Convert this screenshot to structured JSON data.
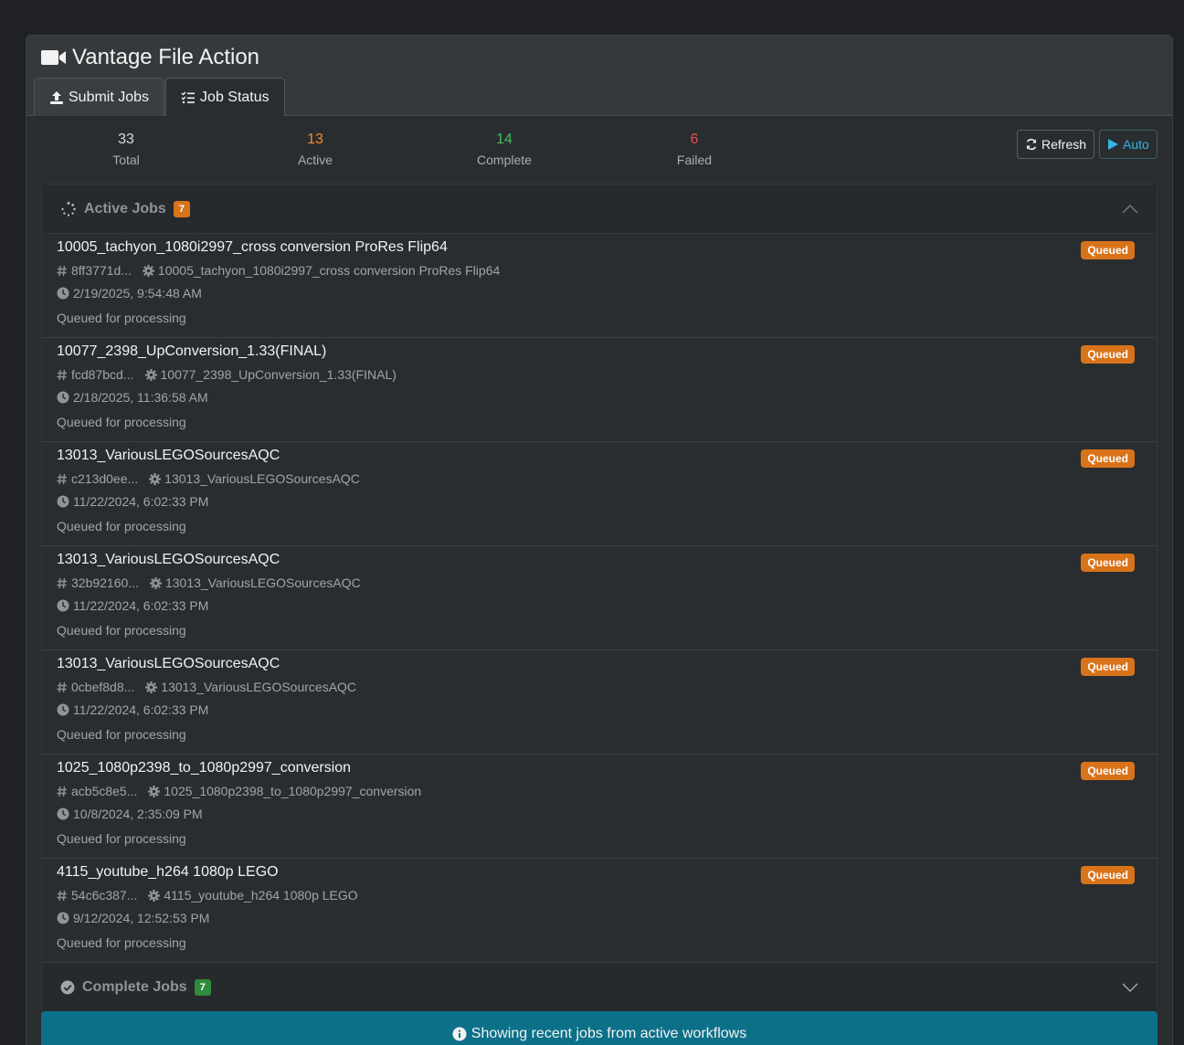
{
  "app": {
    "title": "Vantage File Action",
    "icon": "video-camera-icon"
  },
  "tabs": [
    {
      "label": "Submit Jobs",
      "icon": "upload-icon",
      "active": false
    },
    {
      "label": "Job Status",
      "icon": "list-check-icon",
      "active": true
    }
  ],
  "stats": {
    "total": {
      "value": "33",
      "label": "Total",
      "color": "#d9d9d9"
    },
    "active": {
      "value": "13",
      "label": "Active",
      "color": "#f08b2e"
    },
    "complete": {
      "value": "14",
      "label": "Complete",
      "color": "#3fbf5c"
    },
    "failed": {
      "value": "6",
      "label": "Failed",
      "color": "#e0524d"
    }
  },
  "toolbar": {
    "refresh_label": "Refresh",
    "auto_label": "Auto"
  },
  "active_section": {
    "title": "Active Jobs",
    "count": "7"
  },
  "jobs": [
    {
      "name": "10005_tachyon_1080i2997_cross conversion ProRes Flip64",
      "id": "8ff3771d...",
      "workflow": "10005_tachyon_1080i2997_cross conversion ProRes Flip64",
      "time": "2/19/2025, 9:54:48 AM",
      "message": "Queued for processing",
      "status": "Queued"
    },
    {
      "name": "10077_2398_UpConversion_1.33(FINAL)",
      "id": "fcd87bcd...",
      "workflow": "10077_2398_UpConversion_1.33(FINAL)",
      "time": "2/18/2025, 11:36:58 AM",
      "message": "Queued for processing",
      "status": "Queued"
    },
    {
      "name": "13013_VariousLEGOSourcesAQC",
      "id": "c213d0ee...",
      "workflow": "13013_VariousLEGOSourcesAQC",
      "time": "11/22/2024, 6:02:33 PM",
      "message": "Queued for processing",
      "status": "Queued"
    },
    {
      "name": "13013_VariousLEGOSourcesAQC",
      "id": "32b92160...",
      "workflow": "13013_VariousLEGOSourcesAQC",
      "time": "11/22/2024, 6:02:33 PM",
      "message": "Queued for processing",
      "status": "Queued"
    },
    {
      "name": "13013_VariousLEGOSourcesAQC",
      "id": "0cbef8d8...",
      "workflow": "13013_VariousLEGOSourcesAQC",
      "time": "11/22/2024, 6:02:33 PM",
      "message": "Queued for processing",
      "status": "Queued"
    },
    {
      "name": "1025_1080p2398_to_1080p2997_conversion",
      "id": "acb5c8e5...",
      "workflow": "1025_1080p2398_to_1080p2997_conversion",
      "time": "10/8/2024, 2:35:09 PM",
      "message": "Queued for processing",
      "status": "Queued"
    },
    {
      "name": "4115_youtube_h264 1080p LEGO",
      "id": "54c6c387...",
      "workflow": "4115_youtube_h264 1080p LEGO",
      "time": "9/12/2024, 12:52:53 PM",
      "message": "Queued for processing",
      "status": "Queued"
    }
  ],
  "complete_section": {
    "title": "Complete Jobs",
    "count": "7"
  },
  "info": {
    "text": "Showing recent jobs from active workflows",
    "icon": "info-circle-icon"
  }
}
